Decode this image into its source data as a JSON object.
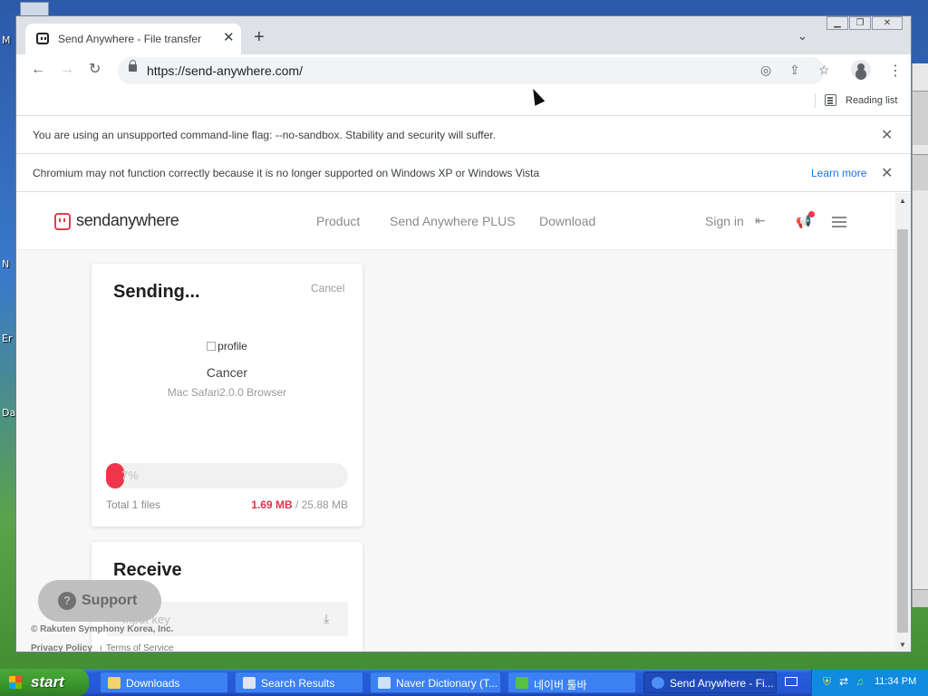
{
  "desktop": {
    "labels": [
      "M",
      "N",
      "Er",
      "Da"
    ]
  },
  "browser": {
    "tab": {
      "title": "Send Anywhere - File transfer"
    },
    "url": "https://send-anywhere.com/",
    "reading_list": "Reading list",
    "infobars": [
      {
        "message": "You are using an unsupported command-line flag: --no-sandbox. Stability and security will suffer."
      },
      {
        "message": "Chromium may not function correctly because it is no longer supported on Windows XP or Windows Vista",
        "link": "Learn more"
      }
    ]
  },
  "site": {
    "logo_text": "sendanywhere",
    "nav": [
      "Product",
      "Send Anywhere PLUS",
      "Download"
    ],
    "sign_in": "Sign in",
    "brand_color": "#f0364b"
  },
  "send_card": {
    "title": "Sending...",
    "cancel": "Cancel",
    "profile_alt": "profile",
    "recipient": "Cancer",
    "device": "Mac Safari2.0.0 Browser",
    "progress_percent": 7,
    "progress_label": "7%",
    "total_files": "Total 1 files",
    "sent_size": "1.69 MB",
    "total_size": "/ 25.88 MB"
  },
  "receive_card": {
    "title": "Receive",
    "input_placeholder": "Input key"
  },
  "support": {
    "label": "Support"
  },
  "footer": {
    "copyright": "© Rakuten Symphony Korea, Inc.",
    "privacy": "Privacy Policy",
    "terms": "Terms of Service"
  },
  "taskbar": {
    "start": "start",
    "tasks": [
      {
        "label": "Downloads"
      },
      {
        "label": "Search Results"
      },
      {
        "label": "Naver Dictionary (T..."
      },
      {
        "label": "네이버 툴바"
      },
      {
        "label": "Send Anywhere - Fi..."
      }
    ],
    "clock": "11:34 PM"
  }
}
